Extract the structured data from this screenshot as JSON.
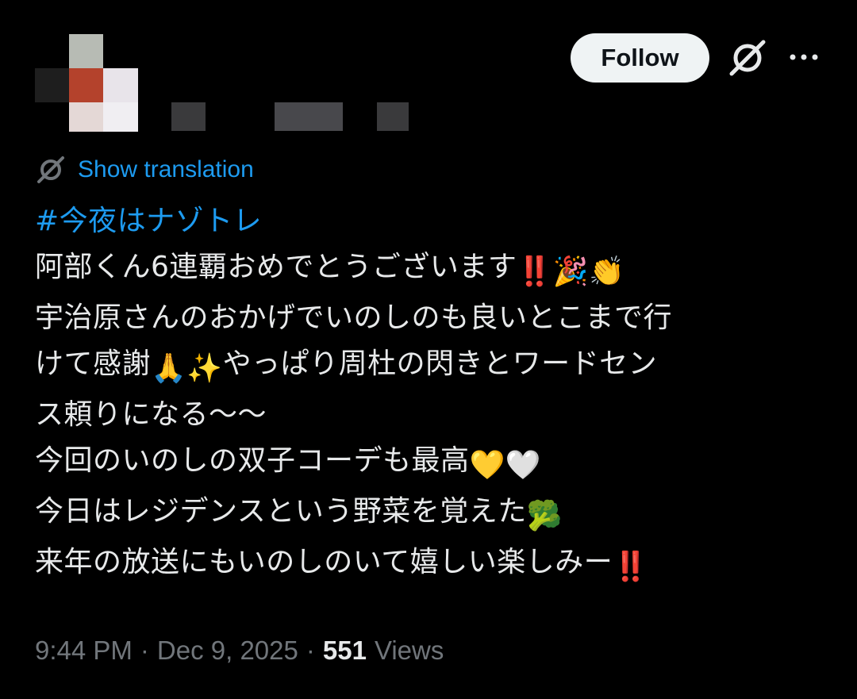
{
  "header": {
    "follow_label": "Follow"
  },
  "translate": {
    "label": "Show translation"
  },
  "tweet": {
    "hashtag": "#今夜はナゾトレ",
    "lines": [
      "阿部くん6連覇おめでとうございます",
      "宇治原さんのおかげでいのしのも良いとこまで行",
      "けて感謝",
      "やっぱり周杜の閃きとワードセン",
      "ス頼りになる〜〜",
      "今回のいのしの双子コーデも最高",
      "今日はレジデンスという野菜を覚えた",
      "来年の放送にもいのしのいて嬉しい楽しみー"
    ],
    "emojis": {
      "double_exclamation": "‼️",
      "party_popper": "🎉",
      "clapping_hands": "👏",
      "folded_hands": "🙏",
      "sparkles": "✨",
      "yellow_heart": "💛",
      "white_heart": "🤍",
      "broccoli": "🥦"
    }
  },
  "meta": {
    "time": "9:44 PM",
    "separator": "·",
    "date": "Dec 9, 2025",
    "views_count": "551",
    "views_label": "Views"
  },
  "colors": {
    "background": "#000000",
    "text": "#e7e9ea",
    "link": "#1d9bf0",
    "muted": "#71767b",
    "follow_bg": "#eff3f4"
  }
}
